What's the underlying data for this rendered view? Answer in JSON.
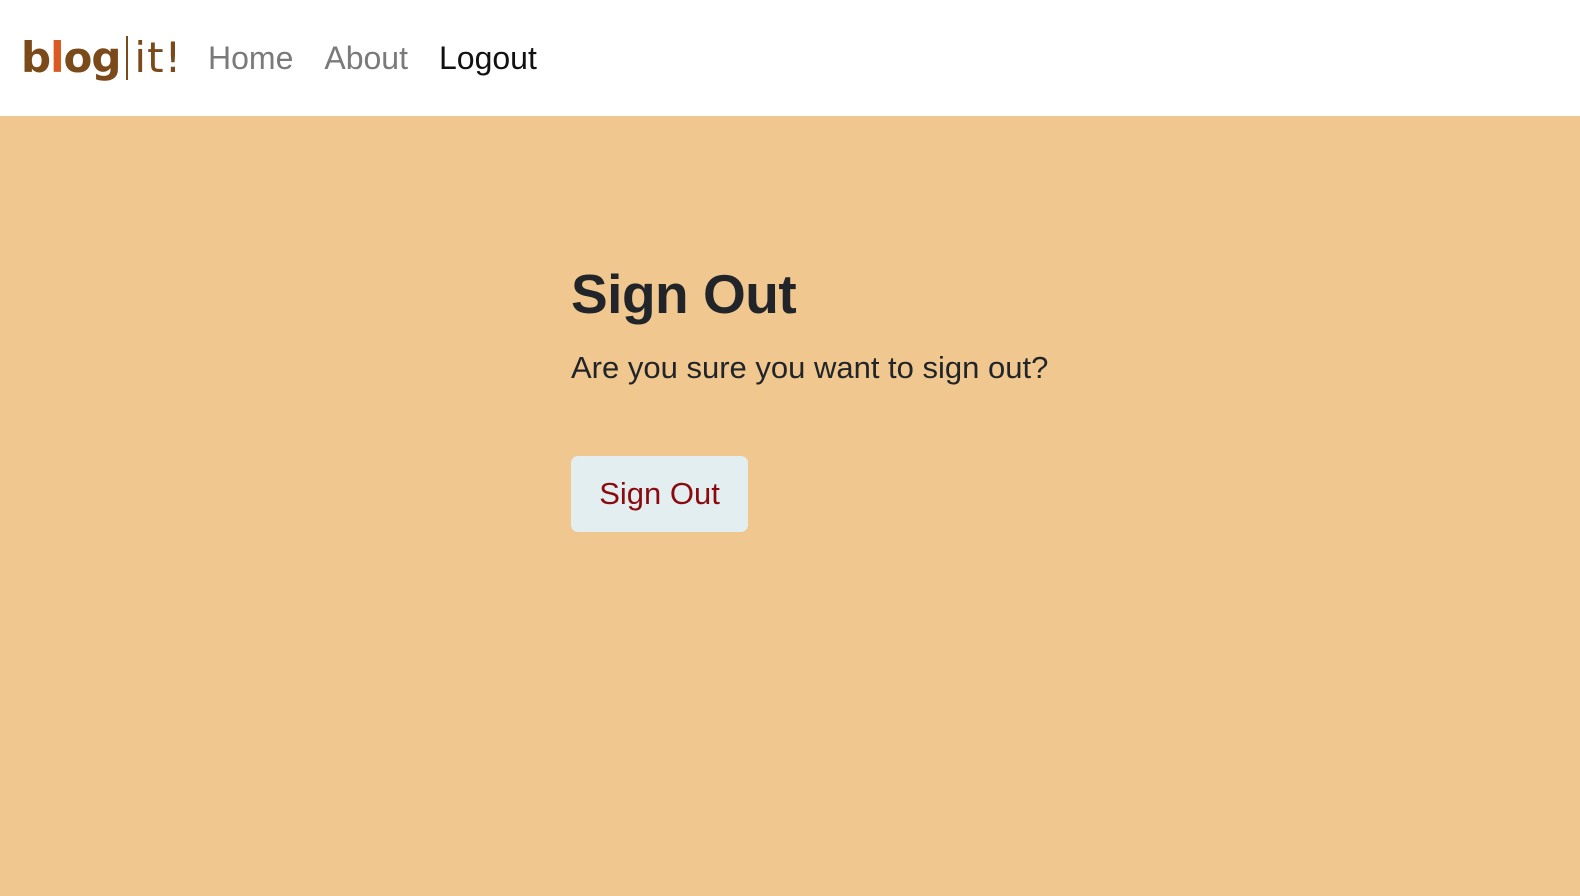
{
  "brand": {
    "part_b": "b",
    "part_l": "l",
    "part_og": "og",
    "part_it": "it!"
  },
  "nav": {
    "items": [
      {
        "label": "Home",
        "active": false
      },
      {
        "label": "About",
        "active": false
      },
      {
        "label": "Logout",
        "active": true
      }
    ]
  },
  "main": {
    "title": "Sign Out",
    "question": "Are you sure you want to sign out?",
    "button_label": "Sign Out"
  },
  "colors": {
    "page_background": "#f0c78e",
    "navbar_background": "#ffffff",
    "brand_brown": "#7a4a1a",
    "brand_accent": "#d95a23",
    "button_background": "#e2eef0",
    "button_text": "#8b0a10"
  }
}
